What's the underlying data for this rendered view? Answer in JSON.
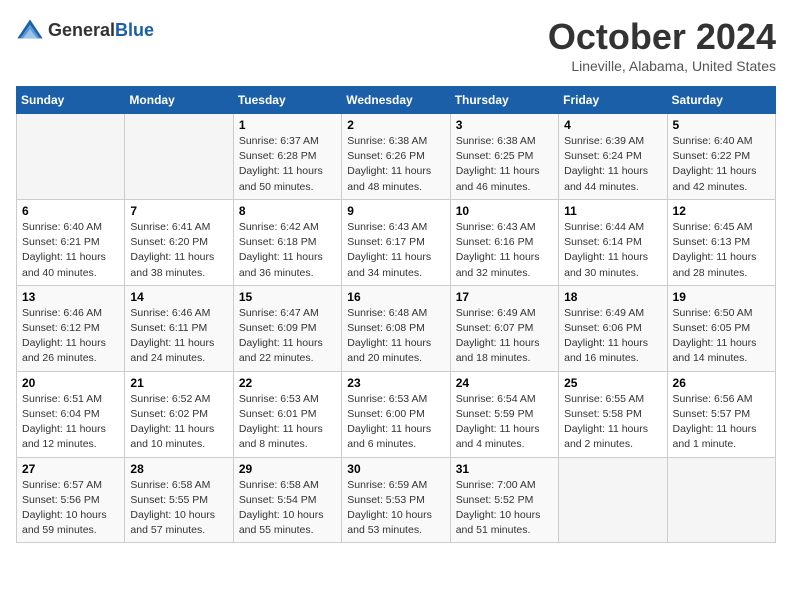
{
  "header": {
    "logo_general": "General",
    "logo_blue": "Blue",
    "title": "October 2024",
    "subtitle": "Lineville, Alabama, United States"
  },
  "days_of_week": [
    "Sunday",
    "Monday",
    "Tuesday",
    "Wednesday",
    "Thursday",
    "Friday",
    "Saturday"
  ],
  "weeks": [
    [
      {
        "day": "",
        "sunrise": "",
        "sunset": "",
        "daylight": ""
      },
      {
        "day": "",
        "sunrise": "",
        "sunset": "",
        "daylight": ""
      },
      {
        "day": "1",
        "sunrise": "Sunrise: 6:37 AM",
        "sunset": "Sunset: 6:28 PM",
        "daylight": "Daylight: 11 hours and 50 minutes."
      },
      {
        "day": "2",
        "sunrise": "Sunrise: 6:38 AM",
        "sunset": "Sunset: 6:26 PM",
        "daylight": "Daylight: 11 hours and 48 minutes."
      },
      {
        "day": "3",
        "sunrise": "Sunrise: 6:38 AM",
        "sunset": "Sunset: 6:25 PM",
        "daylight": "Daylight: 11 hours and 46 minutes."
      },
      {
        "day": "4",
        "sunrise": "Sunrise: 6:39 AM",
        "sunset": "Sunset: 6:24 PM",
        "daylight": "Daylight: 11 hours and 44 minutes."
      },
      {
        "day": "5",
        "sunrise": "Sunrise: 6:40 AM",
        "sunset": "Sunset: 6:22 PM",
        "daylight": "Daylight: 11 hours and 42 minutes."
      }
    ],
    [
      {
        "day": "6",
        "sunrise": "Sunrise: 6:40 AM",
        "sunset": "Sunset: 6:21 PM",
        "daylight": "Daylight: 11 hours and 40 minutes."
      },
      {
        "day": "7",
        "sunrise": "Sunrise: 6:41 AM",
        "sunset": "Sunset: 6:20 PM",
        "daylight": "Daylight: 11 hours and 38 minutes."
      },
      {
        "day": "8",
        "sunrise": "Sunrise: 6:42 AM",
        "sunset": "Sunset: 6:18 PM",
        "daylight": "Daylight: 11 hours and 36 minutes."
      },
      {
        "day": "9",
        "sunrise": "Sunrise: 6:43 AM",
        "sunset": "Sunset: 6:17 PM",
        "daylight": "Daylight: 11 hours and 34 minutes."
      },
      {
        "day": "10",
        "sunrise": "Sunrise: 6:43 AM",
        "sunset": "Sunset: 6:16 PM",
        "daylight": "Daylight: 11 hours and 32 minutes."
      },
      {
        "day": "11",
        "sunrise": "Sunrise: 6:44 AM",
        "sunset": "Sunset: 6:14 PM",
        "daylight": "Daylight: 11 hours and 30 minutes."
      },
      {
        "day": "12",
        "sunrise": "Sunrise: 6:45 AM",
        "sunset": "Sunset: 6:13 PM",
        "daylight": "Daylight: 11 hours and 28 minutes."
      }
    ],
    [
      {
        "day": "13",
        "sunrise": "Sunrise: 6:46 AM",
        "sunset": "Sunset: 6:12 PM",
        "daylight": "Daylight: 11 hours and 26 minutes."
      },
      {
        "day": "14",
        "sunrise": "Sunrise: 6:46 AM",
        "sunset": "Sunset: 6:11 PM",
        "daylight": "Daylight: 11 hours and 24 minutes."
      },
      {
        "day": "15",
        "sunrise": "Sunrise: 6:47 AM",
        "sunset": "Sunset: 6:09 PM",
        "daylight": "Daylight: 11 hours and 22 minutes."
      },
      {
        "day": "16",
        "sunrise": "Sunrise: 6:48 AM",
        "sunset": "Sunset: 6:08 PM",
        "daylight": "Daylight: 11 hours and 20 minutes."
      },
      {
        "day": "17",
        "sunrise": "Sunrise: 6:49 AM",
        "sunset": "Sunset: 6:07 PM",
        "daylight": "Daylight: 11 hours and 18 minutes."
      },
      {
        "day": "18",
        "sunrise": "Sunrise: 6:49 AM",
        "sunset": "Sunset: 6:06 PM",
        "daylight": "Daylight: 11 hours and 16 minutes."
      },
      {
        "day": "19",
        "sunrise": "Sunrise: 6:50 AM",
        "sunset": "Sunset: 6:05 PM",
        "daylight": "Daylight: 11 hours and 14 minutes."
      }
    ],
    [
      {
        "day": "20",
        "sunrise": "Sunrise: 6:51 AM",
        "sunset": "Sunset: 6:04 PM",
        "daylight": "Daylight: 11 hours and 12 minutes."
      },
      {
        "day": "21",
        "sunrise": "Sunrise: 6:52 AM",
        "sunset": "Sunset: 6:02 PM",
        "daylight": "Daylight: 11 hours and 10 minutes."
      },
      {
        "day": "22",
        "sunrise": "Sunrise: 6:53 AM",
        "sunset": "Sunset: 6:01 PM",
        "daylight": "Daylight: 11 hours and 8 minutes."
      },
      {
        "day": "23",
        "sunrise": "Sunrise: 6:53 AM",
        "sunset": "Sunset: 6:00 PM",
        "daylight": "Daylight: 11 hours and 6 minutes."
      },
      {
        "day": "24",
        "sunrise": "Sunrise: 6:54 AM",
        "sunset": "Sunset: 5:59 PM",
        "daylight": "Daylight: 11 hours and 4 minutes."
      },
      {
        "day": "25",
        "sunrise": "Sunrise: 6:55 AM",
        "sunset": "Sunset: 5:58 PM",
        "daylight": "Daylight: 11 hours and 2 minutes."
      },
      {
        "day": "26",
        "sunrise": "Sunrise: 6:56 AM",
        "sunset": "Sunset: 5:57 PM",
        "daylight": "Daylight: 11 hours and 1 minute."
      }
    ],
    [
      {
        "day": "27",
        "sunrise": "Sunrise: 6:57 AM",
        "sunset": "Sunset: 5:56 PM",
        "daylight": "Daylight: 10 hours and 59 minutes."
      },
      {
        "day": "28",
        "sunrise": "Sunrise: 6:58 AM",
        "sunset": "Sunset: 5:55 PM",
        "daylight": "Daylight: 10 hours and 57 minutes."
      },
      {
        "day": "29",
        "sunrise": "Sunrise: 6:58 AM",
        "sunset": "Sunset: 5:54 PM",
        "daylight": "Daylight: 10 hours and 55 minutes."
      },
      {
        "day": "30",
        "sunrise": "Sunrise: 6:59 AM",
        "sunset": "Sunset: 5:53 PM",
        "daylight": "Daylight: 10 hours and 53 minutes."
      },
      {
        "day": "31",
        "sunrise": "Sunrise: 7:00 AM",
        "sunset": "Sunset: 5:52 PM",
        "daylight": "Daylight: 10 hours and 51 minutes."
      },
      {
        "day": "",
        "sunrise": "",
        "sunset": "",
        "daylight": ""
      },
      {
        "day": "",
        "sunrise": "",
        "sunset": "",
        "daylight": ""
      }
    ]
  ]
}
